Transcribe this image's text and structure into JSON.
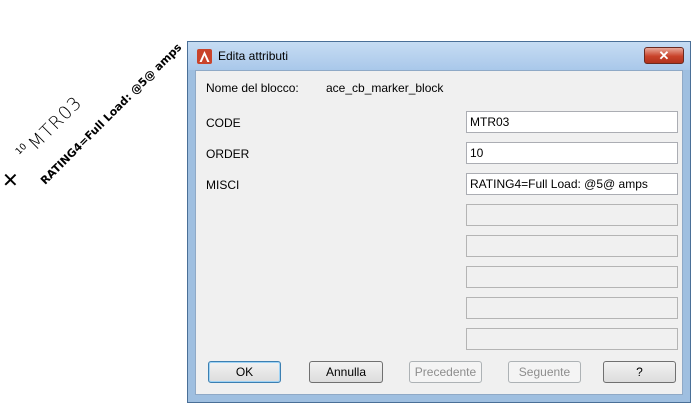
{
  "drawing": {
    "marker": "✕",
    "tag_prefix": "10",
    "tag": "MTR03",
    "rating": "RATING4=Full Load: @5@ amps"
  },
  "dialog": {
    "title": "Edita attributi",
    "close_glyph": "✕",
    "block_name_label": "Nome del blocco:",
    "block_name_value": "ace_cb_marker_block",
    "attributes": [
      {
        "label": "CODE",
        "value": "MTR03"
      },
      {
        "label": "ORDER",
        "value": "10"
      },
      {
        "label": "MISCI",
        "value": "RATING4=Full Load: @5@ amps"
      }
    ],
    "empty_fields": 5,
    "buttons": {
      "ok": "OK",
      "cancel": "Annulla",
      "previous": "Precedente",
      "next": "Seguente",
      "help": "?"
    }
  },
  "colors": {
    "accent_red": "#c9432b",
    "frame_blue": "#9fbfe0"
  },
  "icons": {
    "app": "autocad-logo-icon",
    "close": "close-icon"
  }
}
